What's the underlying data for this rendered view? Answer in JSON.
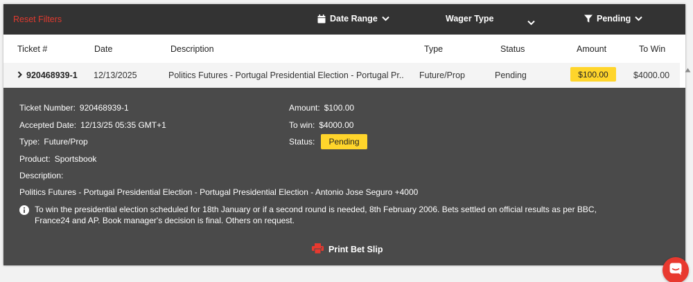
{
  "filters": {
    "reset_label": "Reset Filters",
    "date_range_label": "Date Range",
    "wager_type_label": "Wager Type",
    "pending_label": "Pending"
  },
  "table": {
    "headers": {
      "ticket": "Ticket #",
      "date": "Date",
      "description": "Description",
      "type": "Type",
      "status": "Status",
      "amount": "Amount",
      "to_win": "To Win"
    },
    "rows": [
      {
        "ticket": "920468939-1",
        "date": "12/13/2025",
        "description": "Politics Futures - Portugal Presidential Election - Portugal Pr...",
        "type": "Future/Prop",
        "status": "Pending",
        "amount": "$100.00",
        "to_win": "$4000.00"
      }
    ]
  },
  "detail": {
    "ticket_number_label": "Ticket Number:",
    "ticket_number": "920468939-1",
    "accepted_date_label": "Accepted Date:",
    "accepted_date": "12/13/25 05:35 GMT+1",
    "type_label": "Type:",
    "type": "Future/Prop",
    "product_label": "Product:",
    "product": "Sportsbook",
    "description_label": "Description:",
    "amount_label": "Amount:",
    "amount": "$100.00",
    "to_win_label": "To win:",
    "to_win": "$4000.00",
    "status_label": "Status:",
    "status": "Pending",
    "description_full": "Politics Futures - Portugal Presidential Election - Portugal Presidential Election - Antonio Jose Seguro +4000",
    "note": "To win the presidential election scheduled for 18th January or if a second round is needed, 8th February 2006. Bets settled on official results as per BBC, France24 and AP. Book manager's decision is final. Others on request.",
    "print_label": "Print Bet Slip"
  },
  "colors": {
    "accent_red": "#e03a2f",
    "badge_yellow": "#ffd52b",
    "bar_dark": "#333333",
    "detail_bg": "#4a4a4a"
  }
}
